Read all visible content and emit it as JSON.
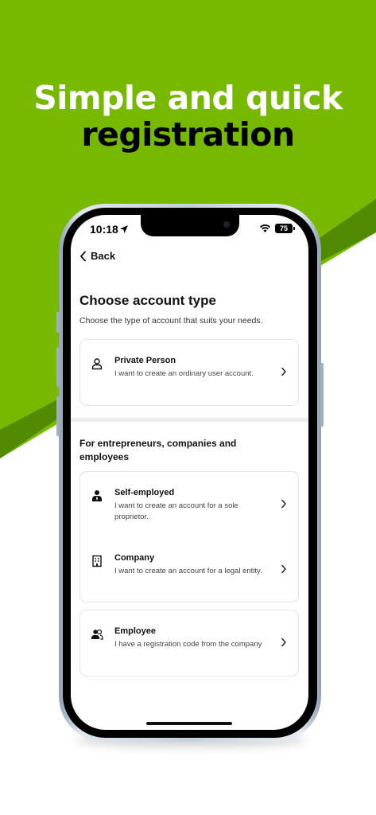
{
  "headline": {
    "line1": "Simple and quick",
    "line2": "registration"
  },
  "colors": {
    "brand_green": "#76b900",
    "dark_green": "#4f8a00",
    "text": "#111111"
  },
  "status_bar": {
    "time": "10:18",
    "battery": "75",
    "icons": [
      "location-arrow-icon",
      "wifi-icon",
      "battery-icon"
    ]
  },
  "nav": {
    "back_label": "Back"
  },
  "page": {
    "title": "Choose account type",
    "subtitle": "Choose the type of account that suits your needs."
  },
  "private": {
    "title": "Private Person",
    "description": "I want to create an ordinary user account.",
    "icon": "person-outline-icon"
  },
  "business": {
    "section_title": "For entrepreneurs, companies and employees",
    "self_employed": {
      "title": "Self-employed",
      "description": "I want to create an account for a sole proprietor.",
      "icon": "businessperson-icon"
    },
    "company": {
      "title": "Company",
      "description": "I want to create an account for a legal entity.",
      "icon": "building-icon"
    },
    "employee": {
      "title": "Employee",
      "description": "I have a registration code from the company",
      "icon": "people-icon"
    }
  }
}
